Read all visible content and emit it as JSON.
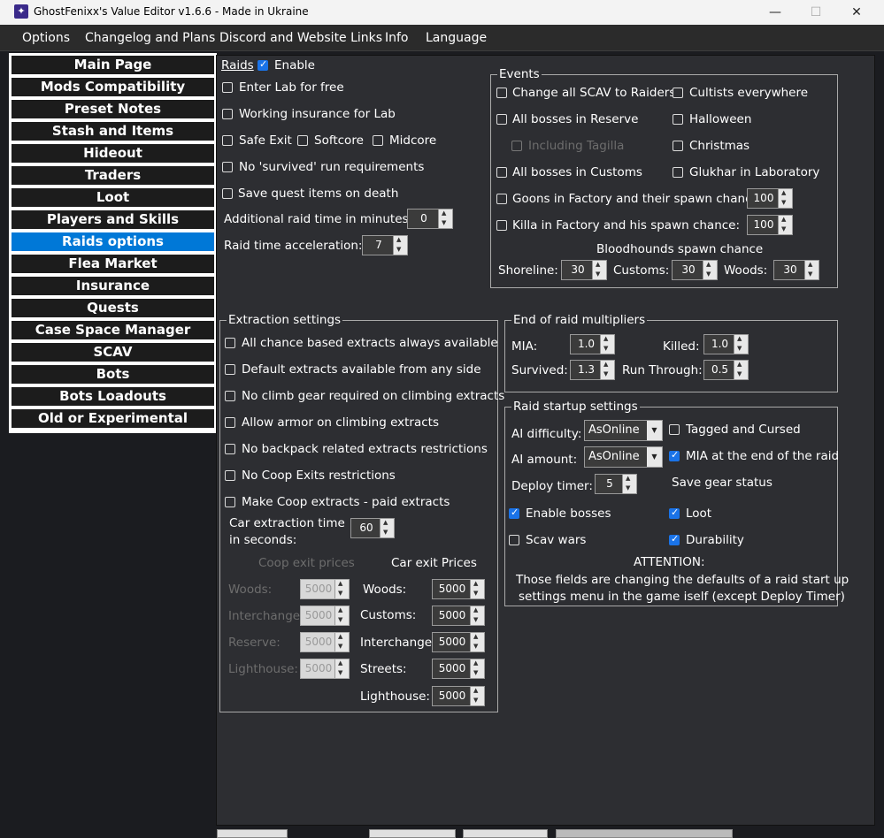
{
  "window": {
    "title": "GhostFenixx's Value Editor v1.6.6 - Made in Ukraine",
    "minimize": "—",
    "maximize": "☐",
    "close": "✕"
  },
  "menu": [
    "Options",
    "Changelog and Plans",
    "Discord and Website Links",
    "Info",
    "Language"
  ],
  "sidebar": [
    "Main Page",
    "Mods Compatibility",
    "Preset Notes",
    "Stash and Items",
    "Hideout",
    "Traders",
    "Loot",
    "Players and Skills",
    "Raids options",
    "Flea Market",
    "Insurance",
    "Quests",
    "Case Space Manager",
    "SCAV",
    "Bots",
    "Bots Loadouts",
    "Old or Experimental"
  ],
  "raids": {
    "header": "Raids",
    "enable": "Enable",
    "enter_lab": "Enter Lab for free",
    "working_insurance": "Working insurance for Lab",
    "safe_exit": "Safe Exit",
    "softcore": "Softcore",
    "midcore": "Midcore",
    "no_survived": "No 'survived' run requirements",
    "save_quest": "Save quest items on death",
    "add_time_label": "Additional raid time in minutes:",
    "add_time_value": "0",
    "accel_label": "Raid time acceleration:",
    "accel_value": "7"
  },
  "events": {
    "title": "Events",
    "scav_raiders": "Change all SCAV to Raiders",
    "cultists": "Cultists everywhere",
    "bosses_reserve": "All bosses in Reserve",
    "halloween": "Halloween",
    "tagilla": "Including Tagilla",
    "christmas": "Christmas",
    "bosses_customs": "All bosses in Customs",
    "glukhar": "Glukhar in Laboratory",
    "goons": "Goons in Factory and their spawn chance:",
    "goons_value": "100",
    "killa": "Killa in Factory and his spawn chance:",
    "killa_value": "100",
    "bloodhounds": "Bloodhounds spawn chance",
    "shoreline": "Shoreline:",
    "shoreline_value": "30",
    "customs": "Customs:",
    "customs_value": "30",
    "woods": "Woods:",
    "woods_value": "30"
  },
  "extraction": {
    "title": "Extraction settings",
    "options": [
      "All chance based extracts always available",
      "Default extracts available from any side",
      "No climb gear required on climbing extracts",
      "Allow armor on climbing extracts",
      "No backpack related extracts restrictions",
      "No Coop Exits restrictions",
      "Make Coop extracts - paid extracts"
    ],
    "car_time_label1": "Car extraction time",
    "car_time_label2": "in seconds:",
    "car_time_value": "60",
    "coop_prices": "Coop exit prices",
    "car_prices": "Car exit Prices",
    "coop_rows": [
      {
        "label": "Woods:",
        "value": "5000"
      },
      {
        "label": "Interchange:",
        "value": "5000"
      },
      {
        "label": "Reserve:",
        "value": "5000"
      },
      {
        "label": "Lighthouse:",
        "value": "5000"
      }
    ],
    "car_rows": [
      {
        "label": "Woods:",
        "value": "5000"
      },
      {
        "label": "Customs:",
        "value": "5000"
      },
      {
        "label": "Interchange:",
        "value": "5000"
      },
      {
        "label": "Streets:",
        "value": "5000"
      },
      {
        "label": "Lighthouse:",
        "value": "5000"
      }
    ]
  },
  "end_raid": {
    "title": "End of raid multipliers",
    "mia": "MIA:",
    "mia_value": "1.0",
    "killed": "Killed:",
    "killed_value": "1.0",
    "survived": "Survived:",
    "survived_value": "1.3",
    "run_through": "Run Through:",
    "run_through_value": "0.5"
  },
  "startup": {
    "title": "Raid startup settings",
    "ai_difficulty": "AI difficulty:",
    "ai_difficulty_value": "AsOnline",
    "ai_amount": "AI amount:",
    "ai_amount_value": "AsOnline",
    "deploy_timer": "Deploy timer:",
    "deploy_timer_value": "5",
    "tagged": "Tagged and Cursed",
    "mia_end": "MIA at the end of the raid",
    "save_gear": "Save gear status",
    "enable_bosses": "Enable bosses",
    "loot": "Loot",
    "scav_wars": "Scav wars",
    "durability": "Durability",
    "attention": "ATTENTION:",
    "note1": "Those fields are changing the defaults of a raid start up",
    "note2": "settings menu in the game iself (except Deploy Timer)"
  }
}
